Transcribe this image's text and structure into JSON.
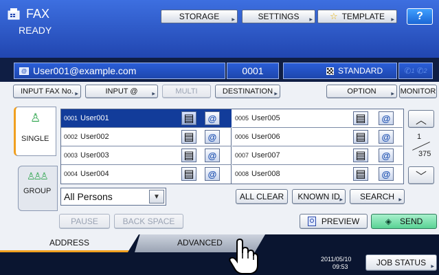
{
  "header": {
    "title": "FAX",
    "status": "READY",
    "storage_label": "STORAGE",
    "settings_label": "SETTINGS",
    "template_label": "TEMPLATE",
    "help_label": "?"
  },
  "recipient_bar": {
    "email": "User001@example.com",
    "count": "0001",
    "quality": "STANDARD",
    "line1": "1",
    "line2": "2"
  },
  "toolbar": {
    "input_fax_label": "INPUT FAX No.",
    "input_at_label": "INPUT @",
    "multi_label": "MULTI",
    "destination_label": "DESTINATION",
    "option_label": "OPTION",
    "monitor_label": "MONITOR"
  },
  "side_tabs": {
    "single_label": "SINGLE",
    "group_label": "GROUP"
  },
  "address_list": {
    "left": [
      {
        "num": "0001",
        "name": "User001",
        "selected": true
      },
      {
        "num": "0002",
        "name": "User002",
        "selected": false
      },
      {
        "num": "0003",
        "name": "User003",
        "selected": false
      },
      {
        "num": "0004",
        "name": "User004",
        "selected": false
      }
    ],
    "right": [
      {
        "num": "0005",
        "name": "User005",
        "selected": false
      },
      {
        "num": "0006",
        "name": "User006",
        "selected": false
      },
      {
        "num": "0007",
        "name": "User007",
        "selected": false
      },
      {
        "num": "0008",
        "name": "User008",
        "selected": false
      }
    ],
    "mail_glyph": "@"
  },
  "pager": {
    "current": "1",
    "total": "375"
  },
  "filter": {
    "selected": "All Persons"
  },
  "actions": {
    "all_clear_label": "ALL CLEAR",
    "known_id_label": "KNOWN ID",
    "search_label": "SEARCH",
    "pause_label": "PAUSE",
    "backspace_label": "BACK SPACE",
    "preview_label": "PREVIEW",
    "send_label": "SEND"
  },
  "bottom_tabs": {
    "address_label": "ADDRESS",
    "advanced_label": "ADVANCED"
  },
  "footer": {
    "date": "2011/05/10",
    "time": "09:53",
    "job_status_label": "JOB STATUS"
  },
  "colors": {
    "header_blue": "#2c56c8",
    "selected_row": "#123c9a",
    "send_green": "#7fe3b0",
    "panel_bg": "#eef1f6"
  }
}
